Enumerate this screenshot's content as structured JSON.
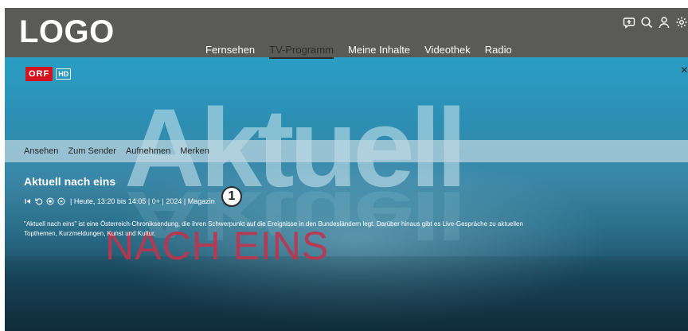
{
  "header": {
    "logo": "LOGO",
    "nav": [
      {
        "label": "Fernsehen",
        "active": false
      },
      {
        "label": "TV-Programm",
        "active": true
      },
      {
        "label": "Meine Inhalte",
        "active": false
      },
      {
        "label": "Videothek",
        "active": false
      },
      {
        "label": "Radio",
        "active": false
      }
    ],
    "icons": [
      "chat-add-icon",
      "search-icon",
      "user-icon",
      "gear-icon"
    ]
  },
  "hero": {
    "channel": {
      "name": "ORF",
      "suffix": "HD"
    },
    "background_text": "Aktuell",
    "sub_text": "NACH EINS",
    "close_symbol": "×"
  },
  "actions": [
    "Ansehen",
    "Zum Sender",
    "Aufnehmen",
    "Merken"
  ],
  "program": {
    "title": "Aktuell nach eins",
    "meta": "| Heute, 13:20 bis 14:05 | 0+ | 2024 | Magazin",
    "meta_icons": [
      "skip-back-icon",
      "restart-icon",
      "record-icon",
      "play-icon"
    ],
    "description": "\"Aktuell nach eins\" ist eine Österreich-Chroniksendung, die ihren Schwerpunkt auf die Ereignisse in den Bundesländern legt. Darüber hinaus gibt es Live-Gespräche zu aktuellen Topthemen, Kurzmeldungen, Kunst und Kultur."
  },
  "annotation": {
    "number": "1"
  },
  "colors": {
    "header_bg": "#5a5a58",
    "orf_red": "#d3141d",
    "accent_nach_eins": "#c0344c"
  }
}
